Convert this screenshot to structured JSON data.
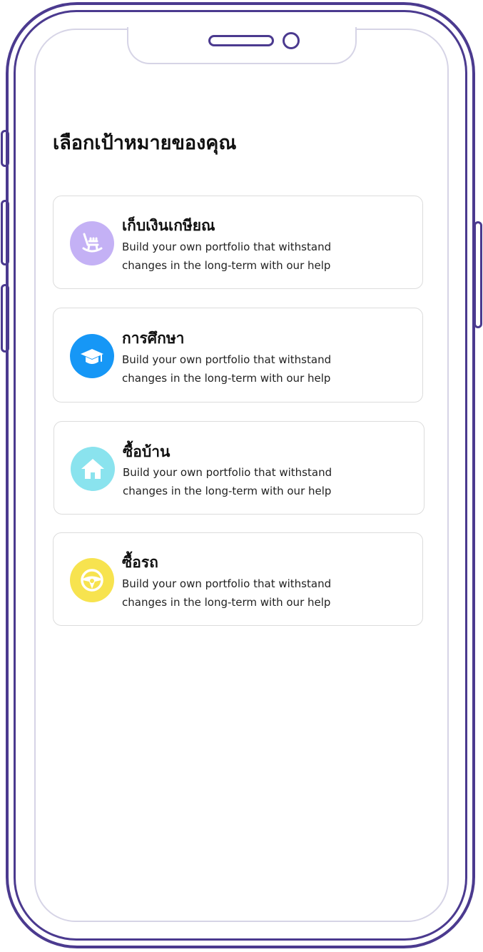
{
  "page": {
    "title": "เลือกเป้าหมายของคุณ"
  },
  "goals": [
    {
      "title": "เก็บเงินเกษียณ",
      "description": "Build your own portfolio that withstand changes in the long-term with our help",
      "icon": "rocking-chair-icon",
      "color": "#c4b1f5"
    },
    {
      "title": "การศึกษา",
      "description": "Build your own portfolio that withstand changes in the long-term with our help",
      "icon": "graduation-cap-icon",
      "color": "#1697f6"
    },
    {
      "title": "ซื้อบ้าน",
      "description": "Build your own portfolio that withstand changes in the long-term with our help",
      "icon": "house-icon",
      "color": "#8ae3ee"
    },
    {
      "title": "ซื้อรถ",
      "description": "Build your own portfolio that withstand changes in the long-term with our help",
      "icon": "steering-wheel-icon",
      "color": "#f7e34f"
    }
  ]
}
